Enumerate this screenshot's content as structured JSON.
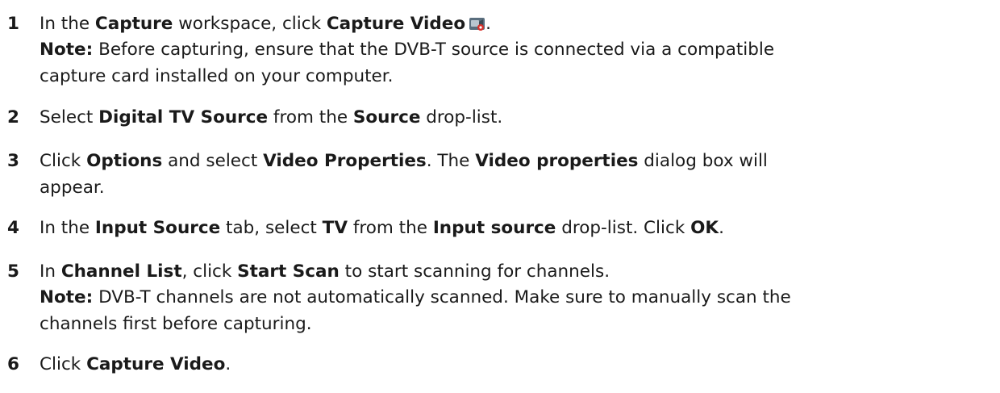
{
  "steps": [
    {
      "number": "1",
      "text": {
        "p1": "In the ",
        "b1": "Capture",
        "p2": " workspace, click ",
        "b2": "Capture Video",
        "icon": "capture-video-camera-icon",
        "p3": "."
      },
      "note": {
        "label": "Note:",
        "line1": "  Before capturing, ensure that the DVB-T source is connected via a compatible",
        "line2": "capture card installed on your computer."
      }
    },
    {
      "number": "2",
      "text": {
        "p1": "Select ",
        "b1": "Digital TV Source",
        "p2": " from the ",
        "b2": "Source",
        "p3": " drop-list."
      }
    },
    {
      "number": "3",
      "text": {
        "p1": "Click ",
        "b1": "Options",
        "p2": " and select ",
        "b2": "Video Properties",
        "p3": ". The ",
        "b3": "Video properties",
        "p4": " dialog box will",
        "line2": "appear."
      }
    },
    {
      "number": "4",
      "text": {
        "p1": "In the ",
        "b1": "Input Source",
        "p2": " tab, select ",
        "b2": "TV",
        "p3": " from the ",
        "b3": "Input source",
        "p4": " drop-list. Click ",
        "b4": "OK",
        "p5": "."
      }
    },
    {
      "number": "5",
      "text": {
        "p1": "In ",
        "b1": "Channel List",
        "p2": ", click ",
        "b2": "Start Scan",
        "p3": " to start scanning for channels."
      },
      "note": {
        "label": "Note:",
        "line1": "  DVB-T channels are not automatically scanned. Make sure to manually scan the",
        "line2": "channels first before capturing."
      }
    },
    {
      "number": "6",
      "text": {
        "p1": "Click ",
        "b1": "Capture Video",
        "p2": "."
      }
    }
  ],
  "colors": {
    "text": "#1a1a1a",
    "icon_body": "#5a6e7e",
    "icon_record": "#d8312b"
  }
}
